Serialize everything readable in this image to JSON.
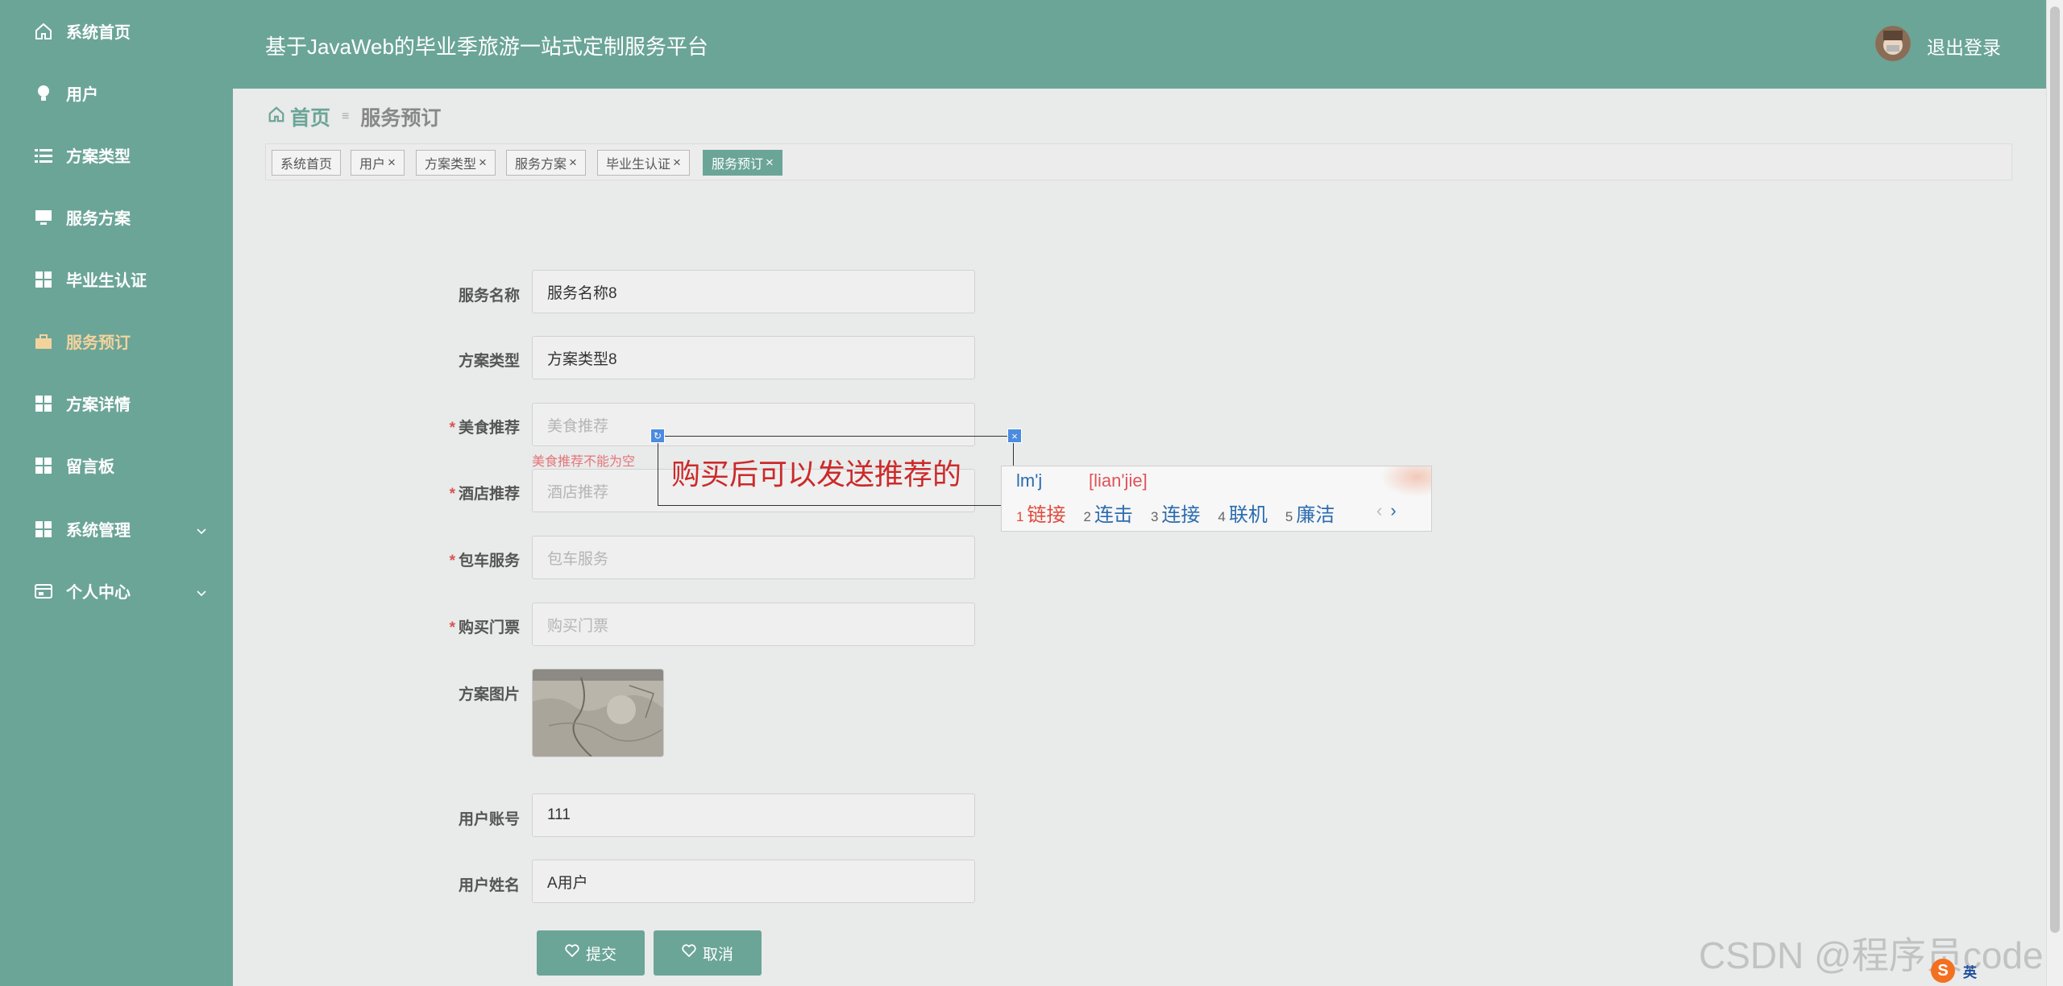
{
  "sidebar": {
    "items": [
      {
        "label": "系统首页"
      },
      {
        "label": "用户"
      },
      {
        "label": "方案类型"
      },
      {
        "label": "服务方案"
      },
      {
        "label": "毕业生认证"
      },
      {
        "label": "服务预订"
      },
      {
        "label": "方案详情"
      },
      {
        "label": "留言板"
      },
      {
        "label": "系统管理"
      },
      {
        "label": "个人中心"
      }
    ]
  },
  "header": {
    "title": "基于JavaWeb的毕业季旅游一站式定制服务平台",
    "logout": "退出登录"
  },
  "breadcrumb": {
    "home": "首页",
    "separator": "≡",
    "current": "服务预订"
  },
  "tags": [
    {
      "label": "系统首页",
      "closable": ""
    },
    {
      "label": "用户",
      "closable": "×"
    },
    {
      "label": "方案类型",
      "closable": "×"
    },
    {
      "label": "服务方案",
      "closable": "×"
    },
    {
      "label": "毕业生认证",
      "closable": "×"
    },
    {
      "label": "服务预订",
      "closable": "×"
    }
  ],
  "form": {
    "service_name": {
      "label": "服务名称",
      "value": "服务名称8"
    },
    "plan_type": {
      "label": "方案类型",
      "value": "方案类型8"
    },
    "food": {
      "label": "美食推荐",
      "placeholder": "美食推荐",
      "error": "美食推荐不能为空"
    },
    "hotel": {
      "label": "酒店推荐",
      "placeholder": "酒店推荐"
    },
    "car": {
      "label": "包车服务",
      "placeholder": "包车服务"
    },
    "ticket": {
      "label": "购买门票",
      "placeholder": "购买门票"
    },
    "plan_image": {
      "label": "方案图片"
    },
    "user_account": {
      "label": "用户账号",
      "value": "111"
    },
    "user_name": {
      "label": "用户姓名",
      "value": "A用户"
    },
    "required_mark": "*",
    "submit": "提交",
    "cancel": "取消"
  },
  "annotation": {
    "text": "购买后可以发送推荐的"
  },
  "ime": {
    "composition": "lm'j",
    "pinyin": "[lian'jie]",
    "candidates": [
      {
        "n": "1",
        "text": "链接"
      },
      {
        "n": "2",
        "text": "连击"
      },
      {
        "n": "3",
        "text": "连接"
      },
      {
        "n": "4",
        "text": "联机"
      },
      {
        "n": "5",
        "text": "廉洁"
      }
    ],
    "prev": "‹",
    "next": "›"
  },
  "watermark": "CSDN @程序员code",
  "tray": {
    "lang": "英"
  },
  "colors": {
    "primary": "#6ba597",
    "active_menu": "#f3d39d",
    "error": "#e4757a",
    "annotation": "#cc2a2a"
  }
}
